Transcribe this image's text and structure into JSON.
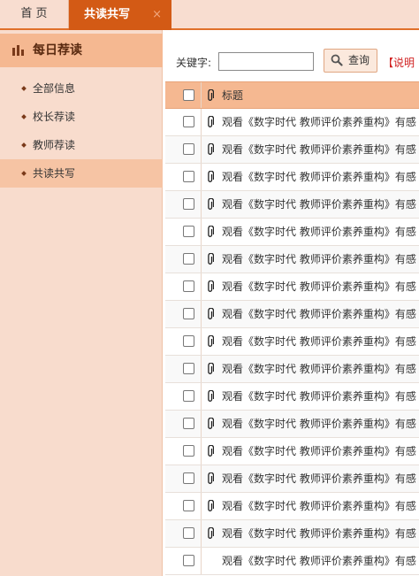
{
  "tabs": {
    "home": "首 页",
    "active": "共读共写",
    "close": "×"
  },
  "sidebar": {
    "header": "每日荐读",
    "items": [
      {
        "label": "全部信息"
      },
      {
        "label": "校长荐读"
      },
      {
        "label": "教师荐读"
      },
      {
        "label": "共读共写"
      }
    ],
    "active_index": 3
  },
  "search": {
    "keyword_label": "关键字:",
    "keyword_value": "",
    "button_label": "查询",
    "note": "【说明"
  },
  "table": {
    "header_title": "标题",
    "rows": [
      {
        "title": "观看《数字时代 教师评价素养重构》有感",
        "has_attachment": true
      },
      {
        "title": "观看《数字时代 教师评价素养重构》有感",
        "has_attachment": true
      },
      {
        "title": "观看《数字时代 教师评价素养重构》有感",
        "has_attachment": true
      },
      {
        "title": "观看《数字时代 教师评价素养重构》有感",
        "has_attachment": true
      },
      {
        "title": "观看《数字时代 教师评价素养重构》有感",
        "has_attachment": true
      },
      {
        "title": "观看《数字时代 教师评价素养重构》有感",
        "has_attachment": true
      },
      {
        "title": "观看《数字时代 教师评价素养重构》有感",
        "has_attachment": true
      },
      {
        "title": "观看《数字时代 教师评价素养重构》有感",
        "has_attachment": true
      },
      {
        "title": "观看《数字时代 教师评价素养重构》有感",
        "has_attachment": true
      },
      {
        "title": "观看《数字时代 教师评价素养重构》有感",
        "has_attachment": true
      },
      {
        "title": "观看《数字时代 教师评价素养重构》有感",
        "has_attachment": true
      },
      {
        "title": "观看《数字时代 教师评价素养重构》有感",
        "has_attachment": true
      },
      {
        "title": "观看《数字时代 教师评价素养重构》有感",
        "has_attachment": true
      },
      {
        "title": "观看《数字时代 教师评价素养重构》有感",
        "has_attachment": true
      },
      {
        "title": "观看《数字时代 教师评价素养重构》有感",
        "has_attachment": true
      },
      {
        "title": "观看《数字时代 教师评价素养重构》有感",
        "has_attachment": true
      },
      {
        "title": "观看《数字时代 教师评价素养重构》有感",
        "has_attachment": false
      }
    ]
  },
  "colors": {
    "accent": "#d35a15",
    "sidebar_bg": "#f8dccd",
    "header_bg": "#f5b891",
    "note": "#d02020"
  }
}
